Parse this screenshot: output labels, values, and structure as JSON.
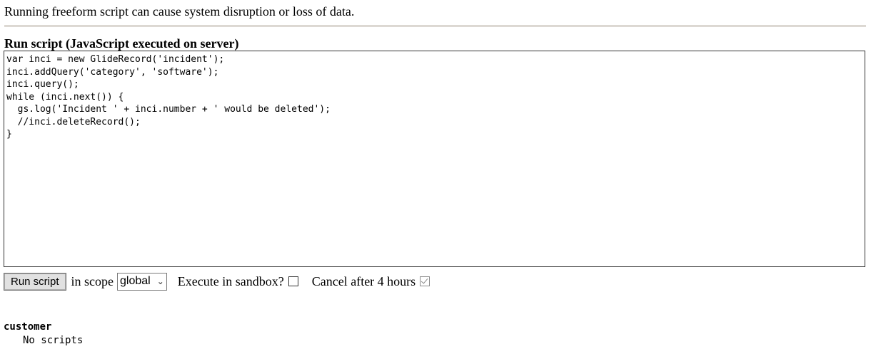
{
  "warning_text": "Running freeform script can cause system disruption or loss of data.",
  "section_title": "Run script (JavaScript executed on server)",
  "script_text": "var inci = new GlideRecord('incident');\ninci.addQuery('category', 'software');\ninci.query();\nwhile (inci.next()) {\n  gs.log('Incident ' + inci.number + ' would be deleted');\n  //inci.deleteRecord();\n}",
  "controls": {
    "run_button_label": "Run script",
    "scope_label": "in scope",
    "scope_selected": "global",
    "sandbox_label": "Execute in sandbox?",
    "sandbox_checked": false,
    "cancel_label": "Cancel after 4 hours",
    "cancel_checked": true
  },
  "results": {
    "scope_name": "customer",
    "message": "No scripts"
  },
  "icons": {
    "dropdown": "chevron-down-icon"
  },
  "colors": {
    "divider": "#8b7d6b",
    "button_bg": "#e1e1e1",
    "editor_border": "#333333"
  }
}
